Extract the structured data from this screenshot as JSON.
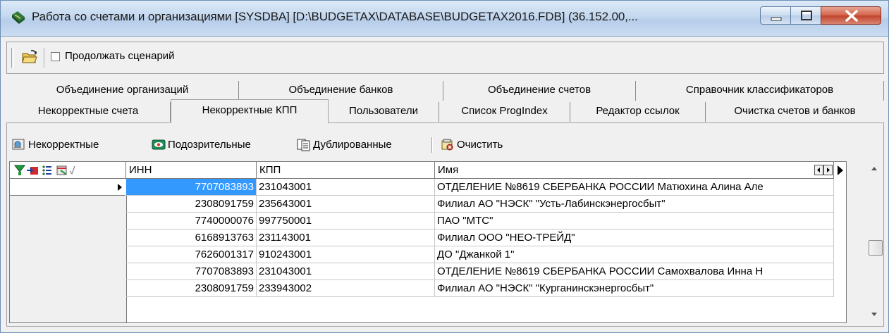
{
  "window": {
    "title": "Работа со счетами и организациями [SYSDBA] [D:\\BUDGETAX\\DATABASE\\BUDGETAX2016.FDB] (36.152.00,..."
  },
  "toolbar": {
    "continue_script_label": "Продолжать сценарий",
    "continue_script_checked": false
  },
  "tabs_row1": [
    {
      "label": "Объединение организаций"
    },
    {
      "label": "Объединение банков"
    },
    {
      "label": "Объединение счетов"
    },
    {
      "label": "Справочник классификаторов"
    }
  ],
  "tabs_row2": [
    {
      "label": "Некорректные счета"
    },
    {
      "label": "Некорректные КПП",
      "active": true
    },
    {
      "label": "Пользователи"
    },
    {
      "label": "Список ProgIndex"
    },
    {
      "label": "Редактор ссылок"
    },
    {
      "label": "Очистка счетов и банков"
    }
  ],
  "actions": {
    "incorrect": "Некорректные",
    "suspicious": "Подозрительные",
    "duplicated": "Дублированные",
    "clear": "Очистить"
  },
  "grid": {
    "columns": {
      "inn": "ИНН",
      "kpp": "КПП",
      "name": "Имя"
    },
    "rows": [
      {
        "inn": "7707083893",
        "kpp": "231043001",
        "name": "ОТДЕЛЕНИЕ №8619 СБЕРБАНКА РОССИИ Матюхина Алина Але"
      },
      {
        "inn": "2308091759",
        "kpp": "235643001",
        "name": "Филиал АО \"НЭСК\" \"Усть-Лабинскэнергосбыт\""
      },
      {
        "inn": "7740000076",
        "kpp": "997750001",
        "name": "ПАО \"МТС\""
      },
      {
        "inn": "6168913763",
        "kpp": "231143001",
        "name": "Филиал ООО \"НЕО-ТРЕЙД\""
      },
      {
        "inn": "7626001317",
        "kpp": "910243001",
        "name": "ДО \"Джанкой 1\""
      },
      {
        "inn": "7707083893",
        "kpp": "231043001",
        "name": "ОТДЕЛЕНИЕ №8619 СБЕРБАНКА РОССИИ Самохвалова Инна Н"
      },
      {
        "inn": "2308091759",
        "kpp": "233943002",
        "name": "Филиал АО \"НЭСК\" \"Курганинскэнергосбыт\""
      }
    ],
    "selected_row": 0
  },
  "colors": {
    "selection": "#3399ff",
    "titlebar": "#c4d8ef",
    "close_button": "#c0422b"
  }
}
